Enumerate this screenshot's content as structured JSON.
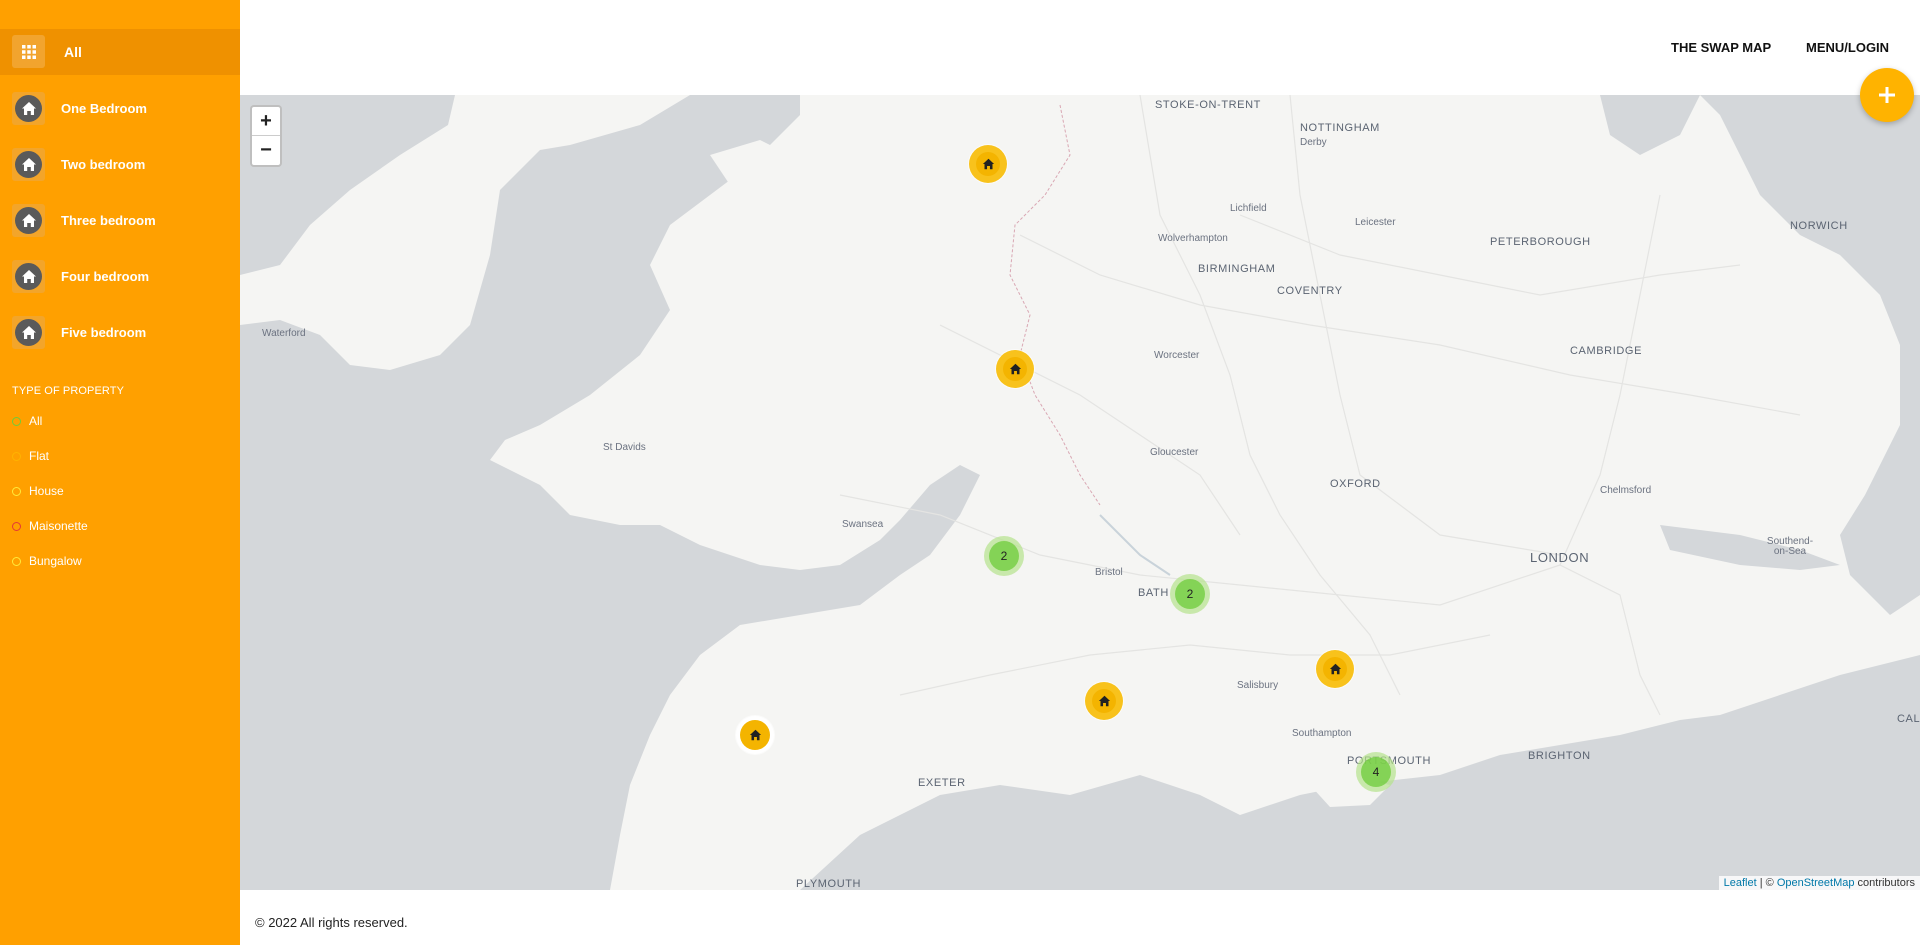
{
  "sidebar": {
    "all_label": "All",
    "categories": [
      {
        "label": "One Bedroom"
      },
      {
        "label": "Two bedroom"
      },
      {
        "label": "Three bedroom"
      },
      {
        "label": "Four bedroom"
      },
      {
        "label": "Five bedroom"
      }
    ],
    "type_title": "TYPE OF PROPERTY",
    "types": [
      {
        "label": "All",
        "color": "#6ecc39"
      },
      {
        "label": "Flat",
        "color": "#ffb300"
      },
      {
        "label": "House",
        "color": "#ffeb3b"
      },
      {
        "label": "Maisonette",
        "color": "#e53935"
      },
      {
        "label": "Bungalow",
        "color": "#ffeb3b"
      }
    ]
  },
  "header": {
    "nav": [
      "THE SWAP MAP",
      "MENU/LOGIN"
    ],
    "fab_icon": "plus-icon"
  },
  "map": {
    "zoom_in": "+",
    "zoom_out": "−",
    "places": [
      "STOKE-ON-TRENT",
      "NOTTINGHAM",
      "Derby",
      "Lichfield",
      "Leicester",
      "Wolverhampton",
      "BIRMINGHAM",
      "COVENTRY",
      "PETERBOROUGH",
      "NORWICH",
      "CAMBRIDGE",
      "Worcester",
      "Gloucester",
      "OXFORD",
      "Chelmsford",
      "LONDON",
      "Southend-on-Sea",
      "Waterford",
      "St Davids",
      "Swansea",
      "Bristol",
      "BATH",
      "Salisbury",
      "Southampton",
      "PORTSMOUTH",
      "BRIGHTON",
      "EXETER",
      "PLYMOUTH",
      "CAL"
    ],
    "clusters": [
      "2",
      "2",
      "4"
    ],
    "marker_icon": "house-icon",
    "attribution": {
      "leaflet": "Leaflet",
      "sep": " | © ",
      "osm": "OpenStreetMap",
      "tail": " contributors"
    }
  },
  "footer": {
    "copyright": "© 2022 All rights reserved."
  }
}
